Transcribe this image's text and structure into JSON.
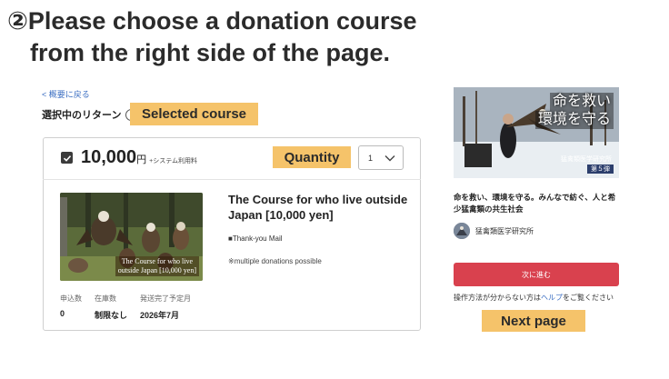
{
  "heading": {
    "line1": "②Please choose a donation course",
    "line2": "from the right side of the page."
  },
  "back_link": "< 概要に戻る",
  "selected": {
    "label": "選択中のリターン",
    "help_icon": "?"
  },
  "callouts": {
    "selected_course": "Selected course",
    "quantity": "Quantity",
    "next_page": "Next page"
  },
  "course": {
    "amount": "10,000",
    "unit": "円",
    "fee_note": "+システム利用料",
    "quantity_value": "1",
    "image_caption_line1": "The Course for who live",
    "image_caption_line2": "outside Japan [10,000 yen]",
    "title": "The Course for who live outside Japan [10,000 yen]",
    "feature": "■Thank-you Mail",
    "note": "※multiple donations possible",
    "stats": [
      {
        "label": "申込数",
        "value": "0"
      },
      {
        "label": "在庫数",
        "value": "制限なし"
      },
      {
        "label": "発送完了予定月",
        "value": "2026年7月"
      }
    ]
  },
  "project": {
    "image_title_line1": "命を救い",
    "image_title_line2": "環境を守る",
    "image_org": "猛禽類医学研究所",
    "image_badge": "第５弾",
    "description": "命を救い、環境を守る。みんなで紡ぐ、人と希少猛禽類の共生社会",
    "org_name": "猛禽類医学研究所"
  },
  "next_button": "次に進む",
  "help": {
    "before": "操作方法が分からない方は",
    "link": "ヘルプ",
    "after": "をご覧ください"
  },
  "colors": {
    "accent_red": "#d9414e",
    "callout_orange": "#f5c36a",
    "link_blue": "#3b6ec2"
  },
  "icons": [
    "check-icon",
    "chevron-down-icon",
    "help-icon"
  ]
}
